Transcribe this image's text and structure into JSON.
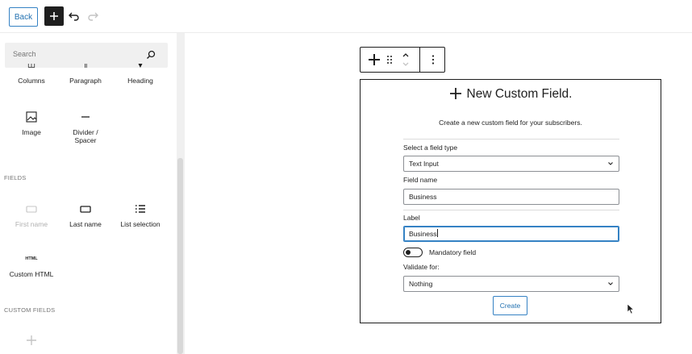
{
  "topbar": {
    "back_label": "Back",
    "add_icon": "plus-icon",
    "undo_icon": "undo-icon",
    "redo_icon": "redo-icon"
  },
  "sidebar": {
    "search_placeholder": "Search",
    "blocks": [
      {
        "label": "Columns",
        "icon": "columns-icon"
      },
      {
        "label": "Paragraph",
        "icon": "paragraph-icon"
      },
      {
        "label": "Heading",
        "icon": "heading-icon"
      },
      {
        "label": "Image",
        "icon": "image-icon"
      },
      {
        "label": "Divider /",
        "label2": "Spacer",
        "icon": "divider-icon"
      }
    ],
    "fields_title": "FIELDS",
    "fields": [
      {
        "label": "First name",
        "icon": "input-icon",
        "disabled": true
      },
      {
        "label": "Last name",
        "icon": "input-icon"
      },
      {
        "label": "List selection",
        "icon": "list-icon"
      },
      {
        "label": "Custom HTML",
        "icon_text": "HTML"
      }
    ],
    "custom_fields_title": "CUSTOM FIELDS"
  },
  "form": {
    "title": "New Custom Field.",
    "description": "Create a new custom field for your subscribers.",
    "field_type_label": "Select a field type",
    "field_type_value": "Text Input",
    "field_name_label": "Field name",
    "field_name_value": "Business",
    "label_label": "Label",
    "label_value": "Business",
    "mandatory_label": "Mandatory field",
    "validate_label": "Validate for:",
    "validate_value": "Nothing",
    "create_label": "Create"
  },
  "colors": {
    "accent": "#2271b1",
    "dark": "#1e1e1e"
  }
}
